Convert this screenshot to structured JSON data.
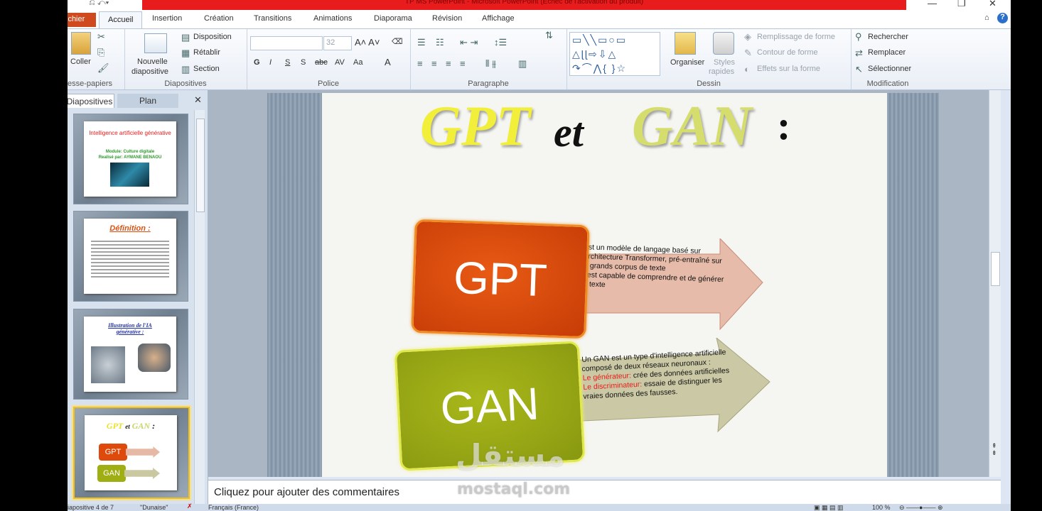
{
  "window": {
    "title": "TP MS PowerPoint - Microsoft PowerPoint (Échec de l'activation du produit)",
    "minimize": "—",
    "restore": "❐",
    "close": "✕"
  },
  "tabs": {
    "file": "ichier",
    "accueil": "Accueil",
    "insertion": "Insertion",
    "creation": "Création",
    "transitions": "Transitions",
    "animations": "Animations",
    "diaporama": "Diaporama",
    "revision": "Révision",
    "affichage": "Affichage"
  },
  "ribbon": {
    "clipboard": {
      "coller": "Coller",
      "label": "esse-papiers"
    },
    "slides": {
      "nouvelle": "Nouvelle",
      "diapositive": "diapositive",
      "disposition": "Disposition",
      "retablir": "Rétablir",
      "section": "Section",
      "label": "Diapositives"
    },
    "font": {
      "size": "32",
      "label": "Police"
    },
    "paragraph": {
      "label": "Paragraphe"
    },
    "drawing": {
      "organiser": "Organiser",
      "styles": "Styles",
      "rapides": "rapides",
      "remplissage": "Remplissage de forme",
      "contour": "Contour de forme",
      "effets": "Effets sur la forme",
      "label": "Dessin"
    },
    "editing": {
      "rechercher": "Rechercher",
      "remplacer": "Remplacer",
      "selectionner": "Sélectionner",
      "label": "Modification"
    }
  },
  "panel": {
    "tab_slides": "Diapositives",
    "tab_outline": "Plan",
    "thumbs": [
      {
        "title": "Intelligence artificielle générative",
        "sub1": "Module: Culture digitale",
        "sub2": "Realisé par: AYMANE BENAOU"
      },
      {
        "title": "Définition :"
      },
      {
        "title": "Illustration de l'IA générative :"
      },
      {
        "w1": "GPT",
        "w2": "et",
        "w3": "GAN",
        "w4": ":",
        "b1": "GPT",
        "b2": "GAN"
      }
    ]
  },
  "slide": {
    "title_gpt": "GPT",
    "title_et": "et",
    "title_gan": "GAN",
    "title_colon": ":",
    "box1": "GPT",
    "box2": "GAN",
    "gpt_lines": [
      "est un modèle de langage basé sur",
      "architecture Transformer, pré-entraîné sur",
      "e grands corpus de texte",
      "l est capable de comprendre et de générer",
      "u texte"
    ],
    "gan_line1": "Un GAN est un type d'intelligence artificielle",
    "gan_line2": "composé de deux réseaux neuronaux :",
    "gan_gen_label": "Le générateur:",
    "gan_gen_text": " crée des données artificielles",
    "gan_dis_label": "Le discriminateur:",
    "gan_dis_text": " essaie de distinguer les",
    "gan_line5": "vraies données des fausses."
  },
  "notes": {
    "placeholder": "Cliquez pour ajouter des commentaires"
  },
  "status": {
    "slide": "iapositive 4 de 7",
    "theme": "\"Dunaise\"",
    "lang": "Français (France)",
    "zoom": "100 %"
  },
  "watermark": {
    "arabic": "مستقل",
    "latin": "mostaql.com"
  },
  "colors": {
    "gpt_box": "#dd4a0c",
    "gan_box": "#9fae12",
    "title_gpt": "#f2ef3a",
    "title_gan": "#d5de6c"
  }
}
